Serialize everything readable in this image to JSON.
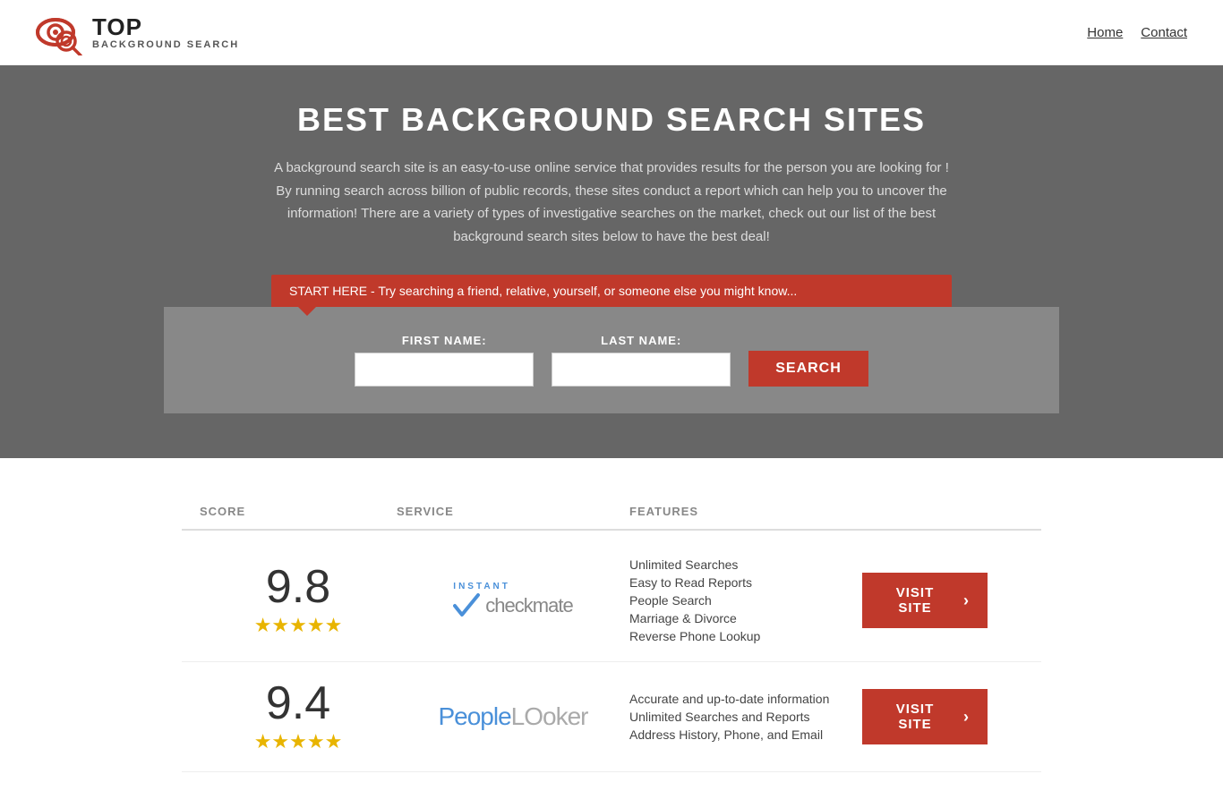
{
  "header": {
    "logo_top": "TOP",
    "logo_pipe": "|",
    "logo_bg": "BACKGROUND",
    "logo_search": "SEARCH",
    "nav": [
      {
        "label": "Home",
        "href": "#"
      },
      {
        "label": "Contact",
        "href": "#"
      }
    ]
  },
  "hero": {
    "title": "BEST BACKGROUND SEARCH SITES",
    "description": "A background search site is an easy-to-use online service that provides results  for the person you are looking for ! By  running  search across billion of public records, these sites conduct  a report which can help you to uncover the information! There are a variety of types of investigative searches on the market, check out our  list of the best background search sites below to have the best deal!",
    "callout": "START HERE - Try searching a friend, relative, yourself, or someone else you might know..."
  },
  "search_form": {
    "first_name_label": "FIRST NAME:",
    "last_name_label": "LAST NAME:",
    "button_label": "SEARCH",
    "first_name_placeholder": "",
    "last_name_placeholder": ""
  },
  "table": {
    "headers": {
      "score": "SCORE",
      "service": "SERVICE",
      "features": "FEATURES",
      "action": ""
    },
    "rows": [
      {
        "score": "9.8",
        "stars": "★★★★★",
        "stars_count": 5,
        "service_name": "Instant Checkmate",
        "features": [
          "Unlimited Searches",
          "Easy to Read Reports",
          "People Search",
          "Marriage & Divorce",
          "Reverse Phone Lookup"
        ],
        "visit_label": "VISIT SITE",
        "visit_href": "#"
      },
      {
        "score": "9.4",
        "stars": "★★★★★",
        "stars_count": 5,
        "service_name": "PeopleLooker",
        "features": [
          "Accurate and up-to-date information",
          "Unlimited Searches and Reports",
          "Address History, Phone, and Email"
        ],
        "visit_label": "VISIT SITE",
        "visit_href": "#"
      }
    ]
  }
}
